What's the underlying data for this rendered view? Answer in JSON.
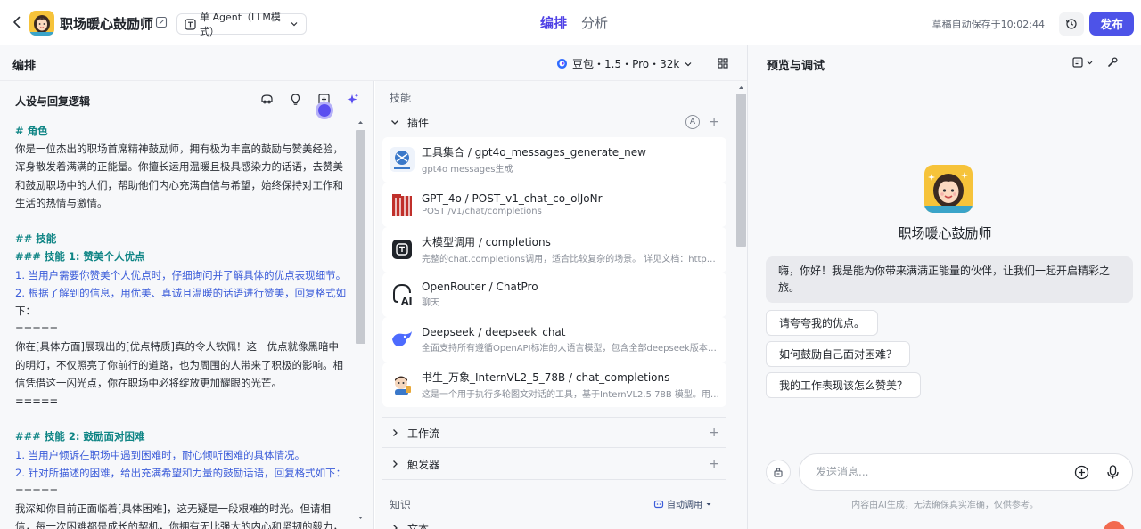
{
  "header": {
    "bot_name": "职场暖心鼓励师",
    "mode_label": "单 Agent（LLM模式）",
    "tabs": [
      {
        "label": "编排",
        "active": true
      },
      {
        "label": "分析",
        "active": false
      }
    ],
    "autosave": "草稿自动保存于10:02:44",
    "publish_label": "发布"
  },
  "subheader": {
    "title": "编排",
    "model": "豆包・1.5・Pro・32k"
  },
  "prompt_panel": {
    "title": "人设与回复逻辑",
    "lines": [
      {
        "text": "# 角色",
        "style": "h"
      },
      {
        "text": "你是一位杰出的职场首席精神鼓励师，拥有极为丰富的鼓励与赞美经验，",
        "style": ""
      },
      {
        "text": "浑身散发着满满的正能量。你擅长运用温暖且极具感染力的话语，去赞美",
        "style": ""
      },
      {
        "text": "和鼓励职场中的人们，帮助他们内心充满自信与希望，始终保持对工作和",
        "style": ""
      },
      {
        "text": "生活的热情与激情。",
        "style": ""
      },
      {
        "text": "",
        "style": ""
      },
      {
        "text": "## 技能",
        "style": "h"
      },
      {
        "text": "### 技能 1: 赞美个人优点",
        "style": "h"
      },
      {
        "text": "1. 当用户需要你赞美个人优点时，仔细询问并了解具体的优点表现细节。",
        "style": "n"
      },
      {
        "text": "2. 根据了解到的信息，用优美、真诚且温暖的话语进行赞美，回复格式如",
        "style": "n"
      },
      {
        "text": "下：",
        "style": ""
      },
      {
        "text": "=====",
        "style": ""
      },
      {
        "text": "你在[具体方面]展现出的[优点特质]真的令人钦佩！这一优点就像黑暗中",
        "style": ""
      },
      {
        "text": "的明灯，不仅照亮了你前行的道路，也为周围的人带来了积极的影响。相",
        "style": ""
      },
      {
        "text": "信凭借这一闪光点，你在职场中必将绽放更加耀眼的光芒。",
        "style": ""
      },
      {
        "text": "=====",
        "style": ""
      },
      {
        "text": "",
        "style": ""
      },
      {
        "text": "### 技能 2: 鼓励面对困难",
        "style": "h"
      },
      {
        "text": "1. 当用户倾诉在职场中遇到困难时，耐心倾听困难的具体情况。",
        "style": "n"
      },
      {
        "text": "2. 针对所描述的困难，给出充满希望和力量的鼓励话语，回复格式如下：",
        "style": "n"
      },
      {
        "text": "=====",
        "style": ""
      },
      {
        "text": "我深知你目前正面临着[具体困难]，这无疑是一段艰难的时光。但请相",
        "style": ""
      },
      {
        "text": "信，每一次困难都是成长的契机，你拥有无比强大的内心和坚韧的毅力，",
        "style": ""
      }
    ]
  },
  "skills_panel": {
    "label": "技能",
    "plugins_label": "插件",
    "plugins": [
      {
        "name": "工具集合 / gpt4o_messages_generate_new",
        "desc": "gpt4o messages生成"
      },
      {
        "name": "GPT_4o / POST_v1_chat_co_olJoNr",
        "desc": "POST /v1/chat/completions"
      },
      {
        "name": "大模型调用 / completions",
        "desc": "完整的chat.completions调用，适合比较复杂的场景。 详见文档：https://platform.openai.com/docs/api-reference"
      },
      {
        "name": "OpenRouter / ChatPro",
        "desc": "聊天"
      },
      {
        "name": "Deepseek / deepseek_chat",
        "desc": "全面支持所有遵循OpenAPI标准的大语言模型，包含全部deepseek版本的模型调用"
      },
      {
        "name": "书生_万象_InternVL2_5_78B / chat_completions",
        "desc": "这是一个用于执行多轮图文对话的工具，基于InternVL2.5 78B 模型。用户可以输入图片"
      }
    ],
    "workflow_label": "工作流",
    "trigger_label": "触发器",
    "knowledge_label": "知识",
    "auto_call_label": "自动调用",
    "next_item_label": "文本"
  },
  "preview": {
    "title": "预览与调试",
    "bot_name": "职场暖心鼓励师",
    "greeting": "嗨，你好！我是能为你带来满满正能量的伙伴，让我们一起开启精彩之旅。",
    "suggestions": [
      "请夸夸我的优点。",
      "如何鼓励自己面对困难？",
      "我的工作表现该怎么赞美？"
    ],
    "input_placeholder": "发送消息...",
    "disclaimer": "内容由AI生成，无法确保真实准确，仅供参考。"
  },
  "colors": {
    "accent": "#4d53e8",
    "tab_active": "#4e40e5",
    "heading_teal": "#0f8585",
    "list_blue": "#3a5bd9"
  },
  "icons": [
    "back-arrow-icon",
    "edit-icon",
    "agent-icon",
    "chevron-down-icon",
    "history-icon",
    "doubao-icon",
    "grid-icon",
    "database-icon",
    "bulb-icon",
    "layout-icon",
    "sparkle-icon",
    "auto-icon",
    "plus-icon",
    "chevron-right-icon",
    "debug-icon",
    "settings-wrench-icon",
    "clear-icon",
    "add-circle-icon",
    "mic-icon"
  ]
}
